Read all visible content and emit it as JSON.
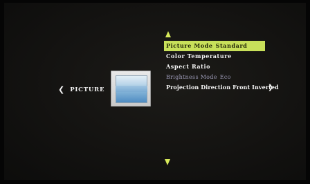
{
  "category": {
    "left_arrow": "❮",
    "label": "PICTURE"
  },
  "icons": {
    "up_arrow": "triangle-up-icon",
    "down_arrow": "triangle-down-icon",
    "picture": "picture-icon"
  },
  "colors": {
    "highlight": "#c8e05a",
    "arrow": "#d7e95a",
    "text": "#f5f5f5",
    "disabled_text": "#9a98b4"
  },
  "menu": {
    "items": [
      {
        "label": "Picture Mode",
        "value": "Standard",
        "state": "selected"
      },
      {
        "label": "Color Temperature",
        "value": "",
        "state": "normal"
      },
      {
        "label": "Aspect Ratio",
        "value": "",
        "state": "normal"
      },
      {
        "label": "Brightness Mode",
        "value": "Eco",
        "state": "disabled"
      },
      {
        "label": "Projection Direction",
        "value": "Front Inverted",
        "state": "normal",
        "right_arrow": "❯"
      }
    ]
  }
}
